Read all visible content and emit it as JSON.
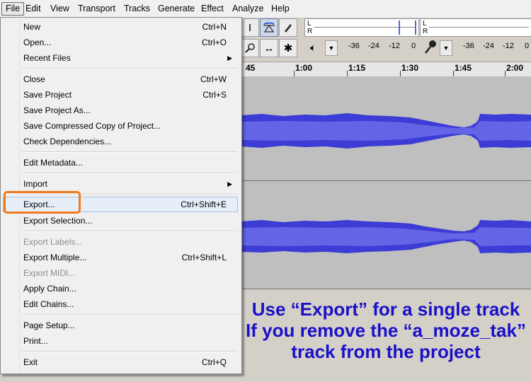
{
  "menubar": {
    "items": [
      "File",
      "Edit",
      "View",
      "Transport",
      "Tracks",
      "Generate",
      "Effect",
      "Analyze",
      "Help"
    ]
  },
  "toolbar": {
    "meter_left_l": "L",
    "meter_left_r": "R",
    "meter_right_l": "L",
    "meter_right_r": "R",
    "playback_db": [
      "-36",
      "-24",
      "-12",
      "0"
    ],
    "record_db": [
      "-36",
      "-24",
      "-12",
      "0"
    ]
  },
  "ruler": {
    "labels": [
      "45",
      "1:00",
      "1:15",
      "1:30",
      "1:45",
      "2:00"
    ]
  },
  "file_menu": {
    "items": [
      {
        "label": "New",
        "shortcut": "Ctrl+N"
      },
      {
        "label": "Open...",
        "shortcut": "Ctrl+O"
      },
      {
        "label": "Recent Files",
        "shortcut": ""
      },
      {
        "label": "Close",
        "shortcut": "Ctrl+W"
      },
      {
        "label": "Save Project",
        "shortcut": "Ctrl+S"
      },
      {
        "label": "Save Project As...",
        "shortcut": ""
      },
      {
        "label": "Save Compressed Copy of Project...",
        "shortcut": ""
      },
      {
        "label": "Check Dependencies...",
        "shortcut": ""
      },
      {
        "label": "Edit Metadata...",
        "shortcut": ""
      },
      {
        "label": "Import",
        "shortcut": ""
      },
      {
        "label": "Export...",
        "shortcut": "Ctrl+Shift+E"
      },
      {
        "label": "Export Selection...",
        "shortcut": ""
      },
      {
        "label": "Export Labels...",
        "shortcut": ""
      },
      {
        "label": "Export Multiple...",
        "shortcut": "Ctrl+Shift+L"
      },
      {
        "label": "Export MIDI...",
        "shortcut": ""
      },
      {
        "label": "Apply Chain...",
        "shortcut": ""
      },
      {
        "label": "Edit Chains...",
        "shortcut": ""
      },
      {
        "label": "Page Setup...",
        "shortcut": ""
      },
      {
        "label": "Print...",
        "shortcut": ""
      },
      {
        "label": "Exit",
        "shortcut": "Ctrl+Q"
      }
    ]
  },
  "caption": {
    "line1": "Use “Export” for a single track",
    "line2": "If you remove the “a_moze_tak”",
    "line3": "track from the project"
  },
  "colors": {
    "waveform": "#3c3cd6",
    "waveform_rms": "#6464e6",
    "highlight": "#f07a1e",
    "caption": "#1a10c8"
  }
}
